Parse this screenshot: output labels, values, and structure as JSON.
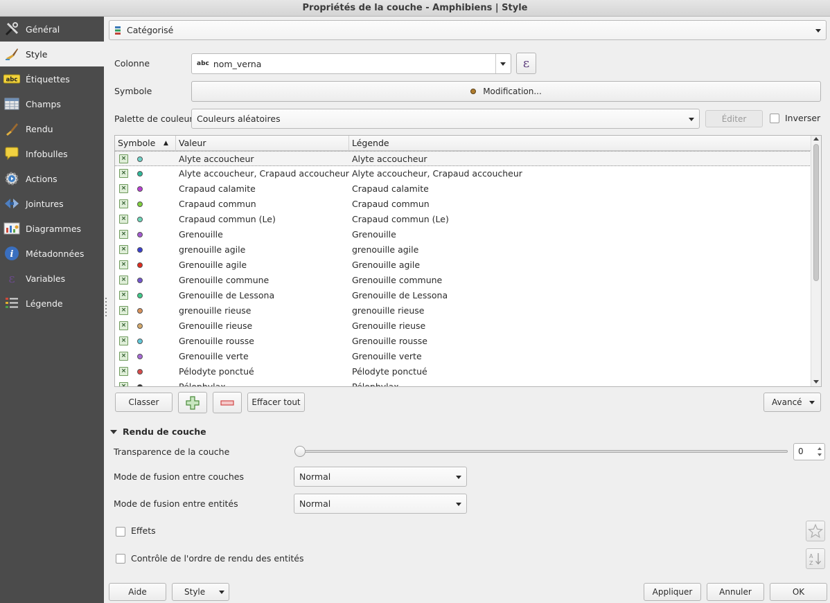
{
  "window": {
    "title": "Propriétés de la couche - Amphibiens | Style"
  },
  "sidebar": {
    "items": [
      {
        "label": "Général",
        "icon": "wrench-hammer-icon"
      },
      {
        "label": "Style",
        "icon": "paintbrush-icon"
      },
      {
        "label": "Étiquettes",
        "icon": "abc-label-icon"
      },
      {
        "label": "Champs",
        "icon": "table-fields-icon"
      },
      {
        "label": "Rendu",
        "icon": "brush-render-icon"
      },
      {
        "label": "Infobulles",
        "icon": "speech-bubble-icon"
      },
      {
        "label": "Actions",
        "icon": "gear-play-icon"
      },
      {
        "label": "Jointures",
        "icon": "join-icon"
      },
      {
        "label": "Diagrammes",
        "icon": "diagram-icon"
      },
      {
        "label": "Métadonnées",
        "icon": "info-icon"
      },
      {
        "label": "Variables",
        "icon": "epsilon-icon"
      },
      {
        "label": "Légende",
        "icon": "legend-icon"
      }
    ],
    "active_index": 1
  },
  "renderer": {
    "type": "Catégorisé"
  },
  "column": {
    "label": "Colonne",
    "type_badge": "abc",
    "value": "nom_verna",
    "expression_symbol": "ε"
  },
  "symbol": {
    "label": "Symbole",
    "button": "Modification..."
  },
  "palette": {
    "label": "Palette de couleur",
    "value": "Couleurs aléatoires",
    "edit_button": "Éditer",
    "invert_label": "Inverser"
  },
  "table": {
    "headers": {
      "symbol": "Symbole",
      "sort_indicator": "▲",
      "value": "Valeur",
      "legend": "Légende"
    },
    "rows": [
      {
        "value": "Alyte accoucheur",
        "legend": "Alyte accoucheur",
        "color": "#6fd1c7"
      },
      {
        "value": "Alyte accoucheur, Crapaud accoucheur",
        "legend": "Alyte accoucheur, Crapaud accoucheur",
        "color": "#2fb89a"
      },
      {
        "value": "Crapaud calamite",
        "legend": "Crapaud calamite",
        "color": "#b93fd3"
      },
      {
        "value": "Crapaud commun",
        "legend": "Crapaud commun",
        "color": "#7fcf3c"
      },
      {
        "value": "Crapaud commun (Le)",
        "legend": "Crapaud commun (Le)",
        "color": "#6ed6b8"
      },
      {
        "value": "Grenouille",
        "legend": "Grenouille",
        "color": "#a35ad0"
      },
      {
        "value": "grenouille agile",
        "legend": "grenouille agile",
        "color": "#3a3fd1"
      },
      {
        "value": "Grenouille agile",
        "legend": "Grenouille agile",
        "color": "#e02b1e"
      },
      {
        "value": "Grenouille commune",
        "legend": "Grenouille commune",
        "color": "#7456cf"
      },
      {
        "value": "Grenouille de Lessona",
        "legend": "Grenouille de Lessona",
        "color": "#3fc98a"
      },
      {
        "value": "grenouille rieuse",
        "legend": "grenouille rieuse",
        "color": "#d9915a"
      },
      {
        "value": "Grenouille rieuse",
        "legend": "Grenouille rieuse",
        "color": "#d4a86a"
      },
      {
        "value": "Grenouille rousse",
        "legend": "Grenouille rousse",
        "color": "#62c8d9"
      },
      {
        "value": "Grenouille verte",
        "legend": "Grenouille verte",
        "color": "#a86bd6"
      },
      {
        "value": "Pélodyte ponctué",
        "legend": "Pélodyte ponctué",
        "color": "#d84a4a"
      },
      {
        "value": "Pélophylax",
        "legend": "Pélophylax",
        "color": "#333333"
      }
    ]
  },
  "table_actions": {
    "classify": "Classer",
    "add_icon": "plus-icon",
    "remove_icon": "minus-icon",
    "clear_all": "Effacer tout",
    "advanced": "Avancé"
  },
  "layer_rendering": {
    "title": "Rendu de couche",
    "transparency_label": "Transparence de la couche",
    "transparency_value": "0",
    "layer_blend_label": "Mode de fusion entre couches",
    "layer_blend_value": "Normal",
    "feature_blend_label": "Mode de fusion entre entités",
    "feature_blend_value": "Normal",
    "effects_label": "Effets",
    "order_label": "Contrôle de l'ordre de rendu des entités"
  },
  "footer": {
    "help": "Aide",
    "style": "Style",
    "apply": "Appliquer",
    "cancel": "Annuler",
    "ok": "OK"
  }
}
